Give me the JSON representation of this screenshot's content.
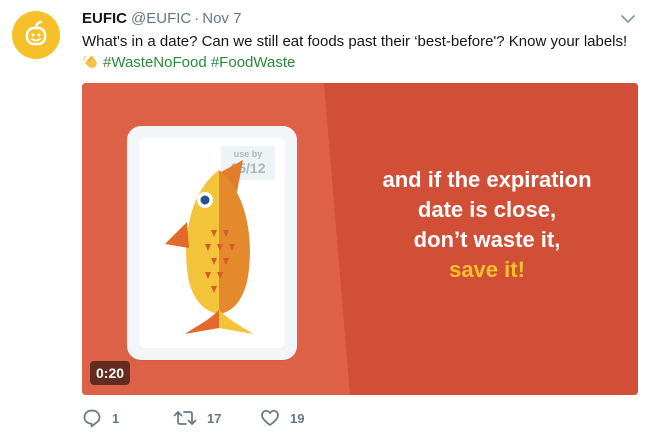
{
  "tweet": {
    "author_name": "EUFIC",
    "author_handle": "@EUFIC",
    "separator": "·",
    "date": "Nov 7",
    "text_main": "What's in a date? Can we still eat foods past their ‘best-before'? Know your labels!",
    "hashtags": [
      "#WasteNoFood",
      "#FoodWaste"
    ]
  },
  "media": {
    "label_use_by": "use by",
    "label_date": "05/12",
    "line1": "and if the expiration",
    "line2": "date is close,",
    "line3": "don’t waste it,",
    "line4_highlight": "save it!",
    "duration": "0:20"
  },
  "actions": {
    "reply_count": "1",
    "retweet_count": "17",
    "like_count": "19"
  },
  "colors": {
    "accent": "#1da1f2",
    "media_background": "#d8573f",
    "highlight": "#f6c02a",
    "secondary_text": "#657786"
  },
  "icons": [
    "avatar-logo-icon",
    "caret-down-icon",
    "clapping-hands-icon",
    "reply-icon",
    "retweet-icon",
    "like-icon",
    "fish-illustration"
  ]
}
